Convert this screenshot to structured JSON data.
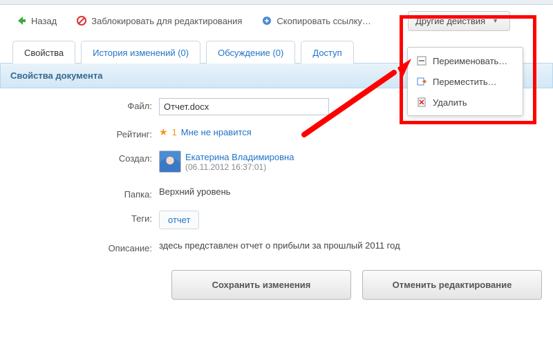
{
  "toolbar": {
    "back": "Назад",
    "lock": "Заблокировать для редактирования",
    "copy": "Скопировать ссылку…",
    "other": "Другие действия"
  },
  "dropdown": {
    "rename": "Переименовать…",
    "move": "Переместить…",
    "delete": "Удалить"
  },
  "tabs": {
    "properties": "Свойства",
    "history": "История изменений (0)",
    "discussion": "Обсуждение (0)",
    "access": "Доступ"
  },
  "section_title": "Свойства документа",
  "labels": {
    "file": "Файл:",
    "rating": "Рейтинг:",
    "created": "Создал:",
    "folder": "Папка:",
    "tags": "Теги:",
    "description": "Описание:"
  },
  "file_name": "Отчет.docx",
  "rating": {
    "count": "1",
    "dislike": "Мне не нравится"
  },
  "creator": {
    "name": "Екатерина Владимировна",
    "date": "(06.11.2012 16:37:01)"
  },
  "folder": "Верхний уровень",
  "tag": "отчет",
  "description": "здесь представлен отчет о прибыли за прошлый 2011 год",
  "buttons": {
    "save": "Сохранить изменения",
    "cancel": "Отменить редактирование"
  }
}
